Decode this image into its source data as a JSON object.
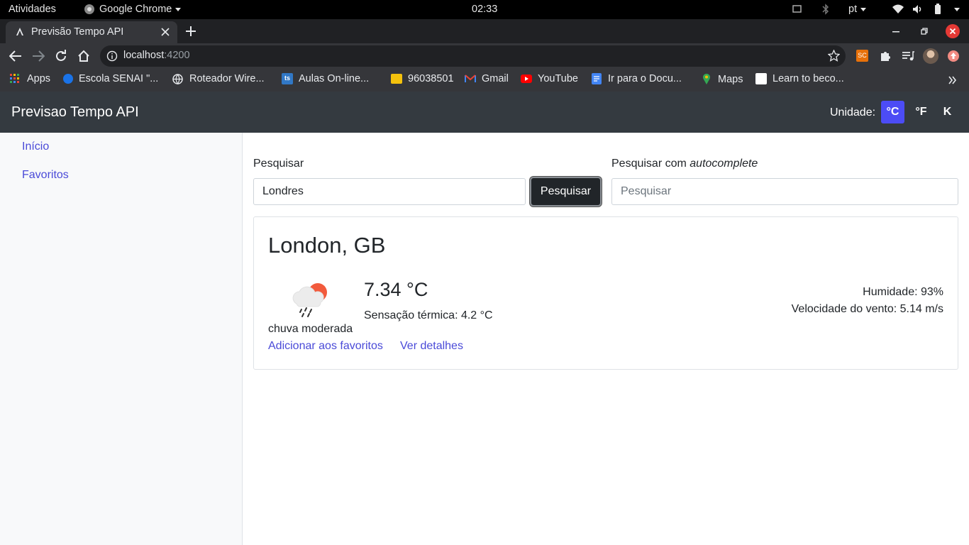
{
  "system_bar": {
    "activities": "Atividades",
    "app_name": "Google Chrome",
    "clock": "02:33",
    "language": "pt"
  },
  "browser": {
    "tab_title": "Previsão Tempo API",
    "url_host": "localhost",
    "url_port": ":4200",
    "extension_badge": "SC",
    "bookmarks": [
      {
        "label": "Apps",
        "icon": "apps-grid-icon",
        "color": "#ea4335"
      },
      {
        "label": "Escola SENAI \"...",
        "icon": "senai-icon",
        "color": "#1a73e8"
      },
      {
        "label": "Roteador Wire...",
        "icon": "globe-icon",
        "color": "#e8eaed"
      },
      {
        "label": "Aulas On-line...",
        "icon": "ts-icon",
        "color": "#3178c6"
      },
      {
        "label": "96038501",
        "icon": "bookmark-yellow-icon",
        "color": "#f4c20d"
      },
      {
        "label": "Gmail",
        "icon": "gmail-icon",
        "color": "#ea4335"
      },
      {
        "label": "YouTube",
        "icon": "youtube-icon",
        "color": "#ff0000"
      },
      {
        "label": "Ir para o Docu...",
        "icon": "docs-icon",
        "color": "#4285f4"
      },
      {
        "label": "Maps",
        "icon": "maps-icon",
        "color": "#34a853"
      },
      {
        "label": "Learn to beco...",
        "icon": "learn-icon",
        "color": "#ffffff"
      }
    ]
  },
  "navbar": {
    "brand": "Previsao Tempo API",
    "unit_label": "Unidade:",
    "units": [
      "°C",
      "°F",
      "K"
    ],
    "active_unit": "°C",
    "active_color": "#4c4cf5"
  },
  "sidebar": {
    "items": [
      "Início",
      "Favoritos"
    ]
  },
  "search": {
    "label": "Pesquisar",
    "value": "Londres",
    "button": "Pesquisar",
    "autocomplete_label_prefix": "Pesquisar com ",
    "autocomplete_label_em": "autocomplete",
    "autocomplete_placeholder": "Pesquisar"
  },
  "weather": {
    "city": "London, GB",
    "temperature": "7.34 °C",
    "feels_like": "Sensação térmica: 4.2 °C",
    "description": "chuva moderada",
    "humidity": "Humidade: 93%",
    "wind": "Velocidade do vento: 5.14 m/s",
    "add_favorite": "Adicionar aos favoritos",
    "details": "Ver detalhes",
    "icon": "rain-cloud-sun-icon"
  }
}
